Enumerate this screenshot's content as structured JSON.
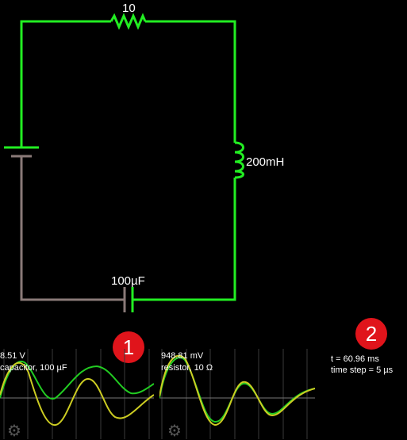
{
  "circuit": {
    "wire_active_color": "#22ee22",
    "wire_inactive_color": "#8a7a78",
    "resistor_label": "10",
    "inductor_label": "200mH",
    "capacitor_label": "100µF"
  },
  "badges": {
    "badge_1": "1",
    "badge_2": "2"
  },
  "scope1": {
    "value": "8.51 V",
    "desc": "capacitor, 100 µF",
    "settings_icon": "gear-icon"
  },
  "scope2": {
    "value": "948.81 mV",
    "desc": "resistor, 10 Ω",
    "settings_icon": "gear-icon"
  },
  "info": {
    "time": "t = 60.96 ms",
    "step": "time step = 5 µs"
  }
}
